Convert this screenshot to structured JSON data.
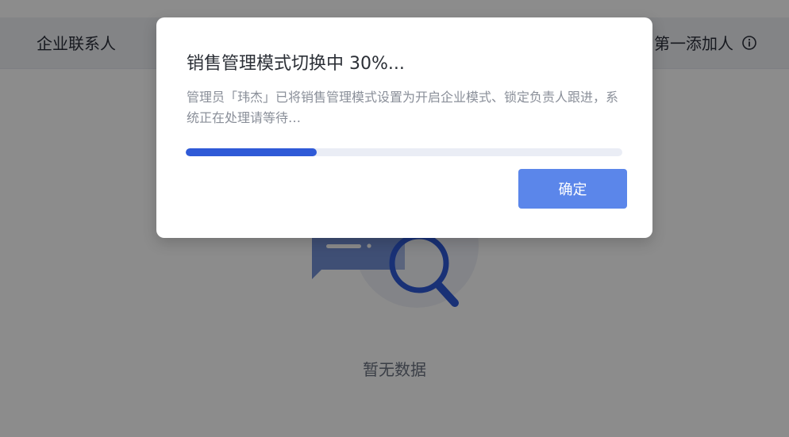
{
  "header": {
    "left_title": "企业联系人",
    "right_label": "第一添加人",
    "info_icon": "info-icon"
  },
  "empty_state": {
    "text": "暂无数据",
    "illustration_icon": "search-magnifier-illustration"
  },
  "modal": {
    "title": "销售管理模式切换中 30%...",
    "description": "管理员「玮杰」已将销售管理模式设置为开启企业模式、锁定负责人跟进，系统正在处理请等待…",
    "progress_percent": 30,
    "confirm_label": "确定"
  },
  "colors": {
    "overlay": "rgba(0,0,0,0.45)",
    "progress": "#2f5ad7",
    "button": "#5b86ea",
    "track": "#eaedf5"
  }
}
